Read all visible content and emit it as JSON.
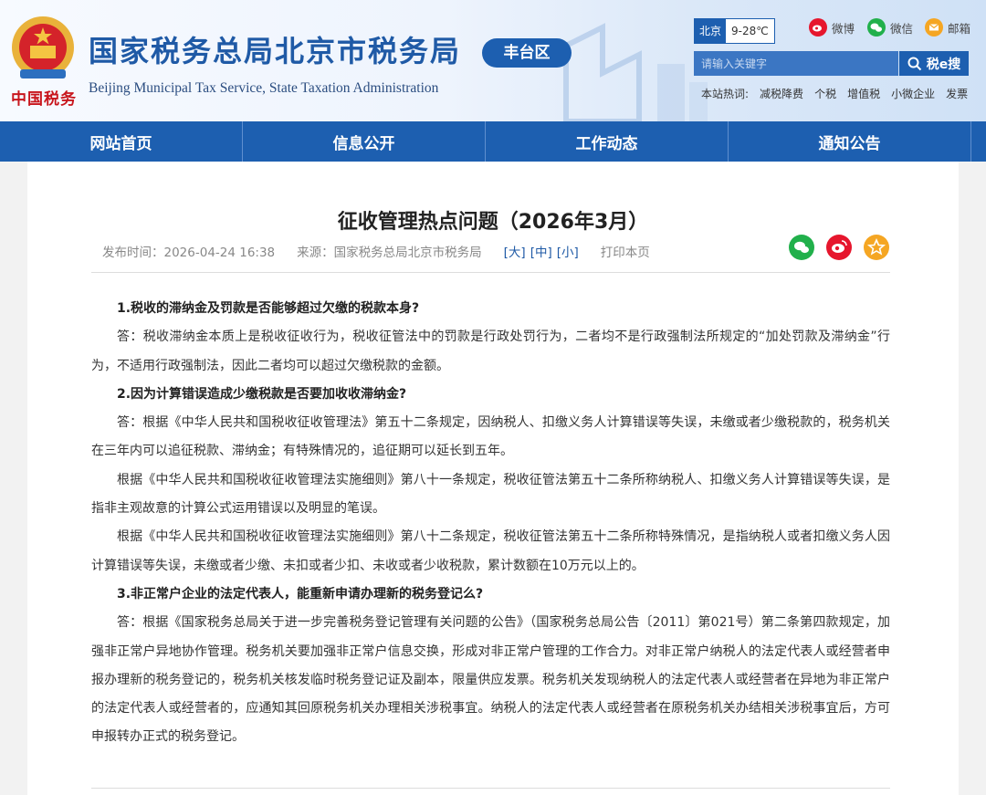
{
  "header": {
    "title": "国家税务总局北京市税务局",
    "subtitle": "Beijing Municipal Tax Service, State Taxation Administration",
    "slogan": "中国税务",
    "district": "丰台区",
    "weather": {
      "city": "北京",
      "temp": "9-28℃"
    },
    "social": {
      "weibo": "微博",
      "wechat": "微信",
      "mail": "邮箱"
    },
    "search": {
      "placeholder": "请输入关键字",
      "button": "税e搜"
    },
    "hotwords": {
      "label": "本站热词:",
      "items": [
        "减税降费",
        "个税",
        "增值税",
        "小微企业",
        "发票"
      ]
    }
  },
  "nav": {
    "items": [
      "网站首页",
      "信息公开",
      "工作动态",
      "通知公告"
    ]
  },
  "article": {
    "title": "征收管理热点问题（2026年3月）",
    "publish": "发布时间：2026-04-24 16:38",
    "source": "来源：国家税务总局北京市税务局",
    "size_large": "[大]",
    "size_medium": "[中]",
    "size_small": "[小]",
    "print": "打印本页",
    "q1": "1.税收的滞纳金及罚款是否能够超过欠缴的税款本身?",
    "a1": "答：税收滞纳金本质上是税收征收行为，税收征管法中的罚款是行政处罚行为，二者均不是行政强制法所规定的“加处罚款及滞纳金”行为，不适用行政强制法，因此二者均可以超过欠缴税款的金额。",
    "q2": "2.因为计算错误造成少缴税款是否要加收收滞纳金?",
    "a2_1": "答：根据《中华人民共和国税收征收管理法》第五十二条规定，因纳税人、扣缴义务人计算错误等失误，未缴或者少缴税款的，税务机关在三年内可以追征税款、滞纳金；有特殊情况的，追征期可以延长到五年。",
    "a2_2": "根据《中华人民共和国税收征收管理法实施细则》第八十一条规定，税收征管法第五十二条所称纳税人、扣缴义务人计算错误等失误，是指非主观故意的计算公式运用错误以及明显的笔误。",
    "a2_3": "根据《中华人民共和国税收征收管理法实施细则》第八十二条规定，税收征管法第五十二条所称特殊情况，是指纳税人或者扣缴义务人因计算错误等失误，未缴或者少缴、未扣或者少扣、未收或者少收税款，累计数额在10万元以上的。",
    "q3": "3.非正常户企业的法定代表人，能重新申请办理新的税务登记么?",
    "a3": "答：根据《国家税务总局关于进一步完善税务登记管理有关问题的公告》（国家税务总局公告〔2011〕第021号）第二条第四款规定，加强非正常户异地协作管理。税务机关要加强非正常户信息交换，形成对非正常户管理的工作合力。对非正常户纳税人的法定代表人或经营者申报办理新的税务登记的，税务机关核发临时税务登记证及副本，限量供应发票。税务机关发现纳税人的法定代表人或经营者在异地为非正常户的法定代表人或经营者的，应通知其回原税务机关办理相关涉税事宜。纳税人的法定代表人或经营者在原税务机关办结相关涉税事宜后，方可申报转办正式的税务登记。"
  },
  "colors": {
    "brand_blue": "#1d5fb0",
    "title_blue": "#1f5aa6",
    "slogan_red": "#c8161d",
    "wechat_green": "#21b04b",
    "weibo_red": "#e6162d",
    "star_yellow": "#f5a623"
  }
}
